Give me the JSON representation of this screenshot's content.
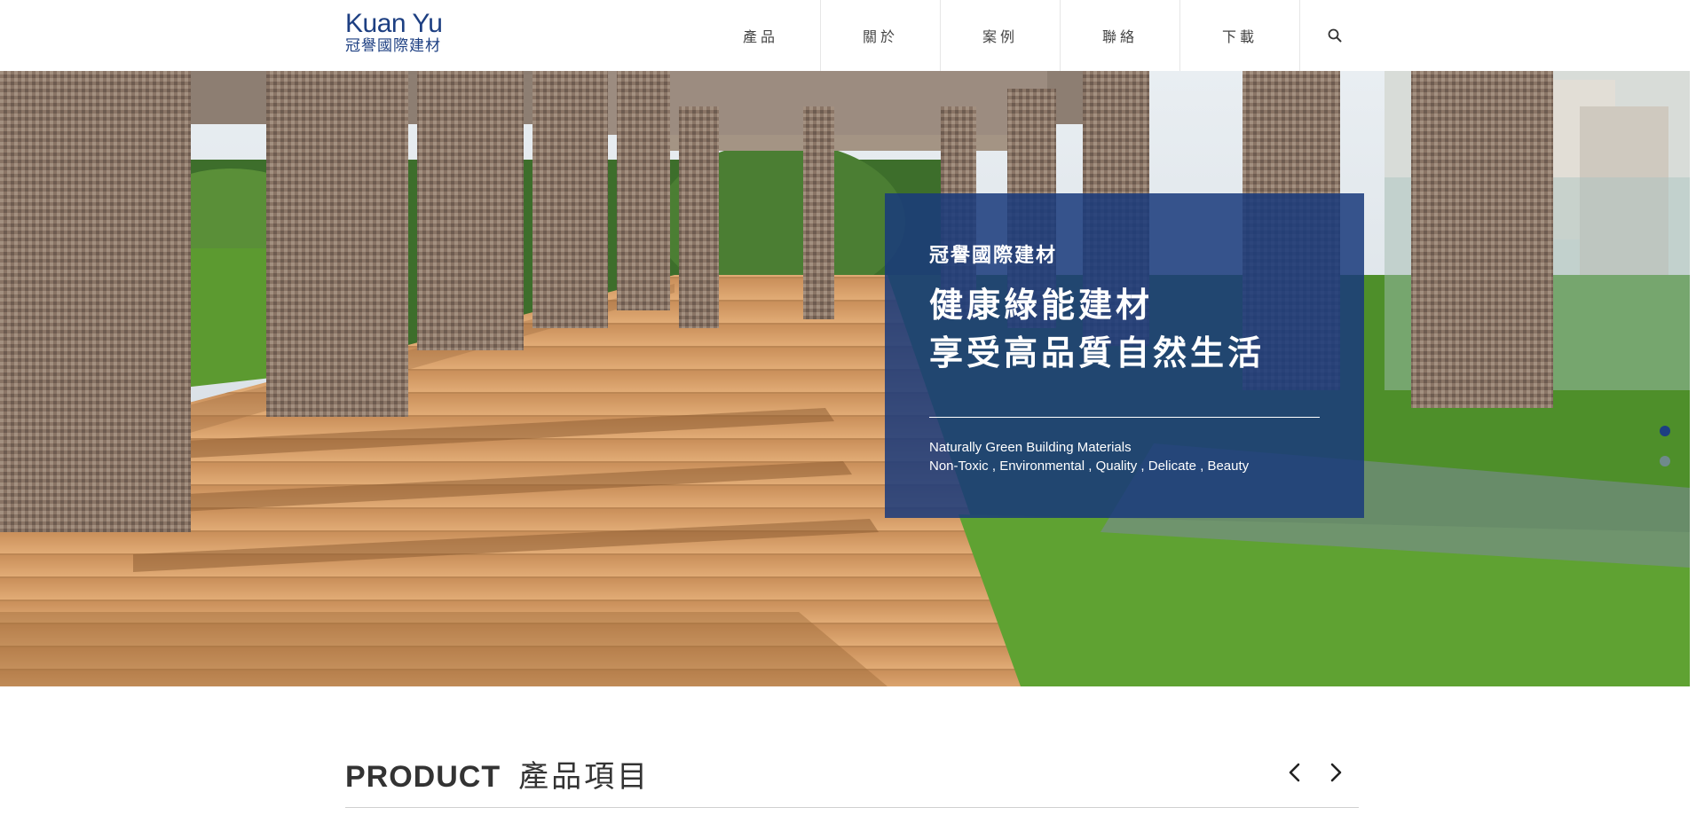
{
  "header": {
    "logo_en": "Kuan Yu",
    "logo_zh": "冠譽國際建材",
    "nav": [
      "產品",
      "關於",
      "案例",
      "聯絡",
      "下載"
    ],
    "search_icon": "search-icon"
  },
  "hero": {
    "kicker": "冠譽國際建材",
    "title_line1": "健康綠能建材",
    "title_line2": "享受高品質自然生活",
    "sub_line1": "Naturally Green Building Materials",
    "sub_line2": "Non-Toxic , Environmental , Quality , Delicate , Beauty",
    "slides": 2,
    "active_slide": 1
  },
  "section": {
    "title_en": "PRODUCT",
    "title_zh": "產品項目",
    "prev_icon": "chevron-left-icon",
    "next_icon": "chevron-right-icon"
  },
  "colors": {
    "brand": "#1d3f82",
    "panel": "#1a3a7c",
    "deck": "#d7a067",
    "grass": "#4e8f2a"
  }
}
